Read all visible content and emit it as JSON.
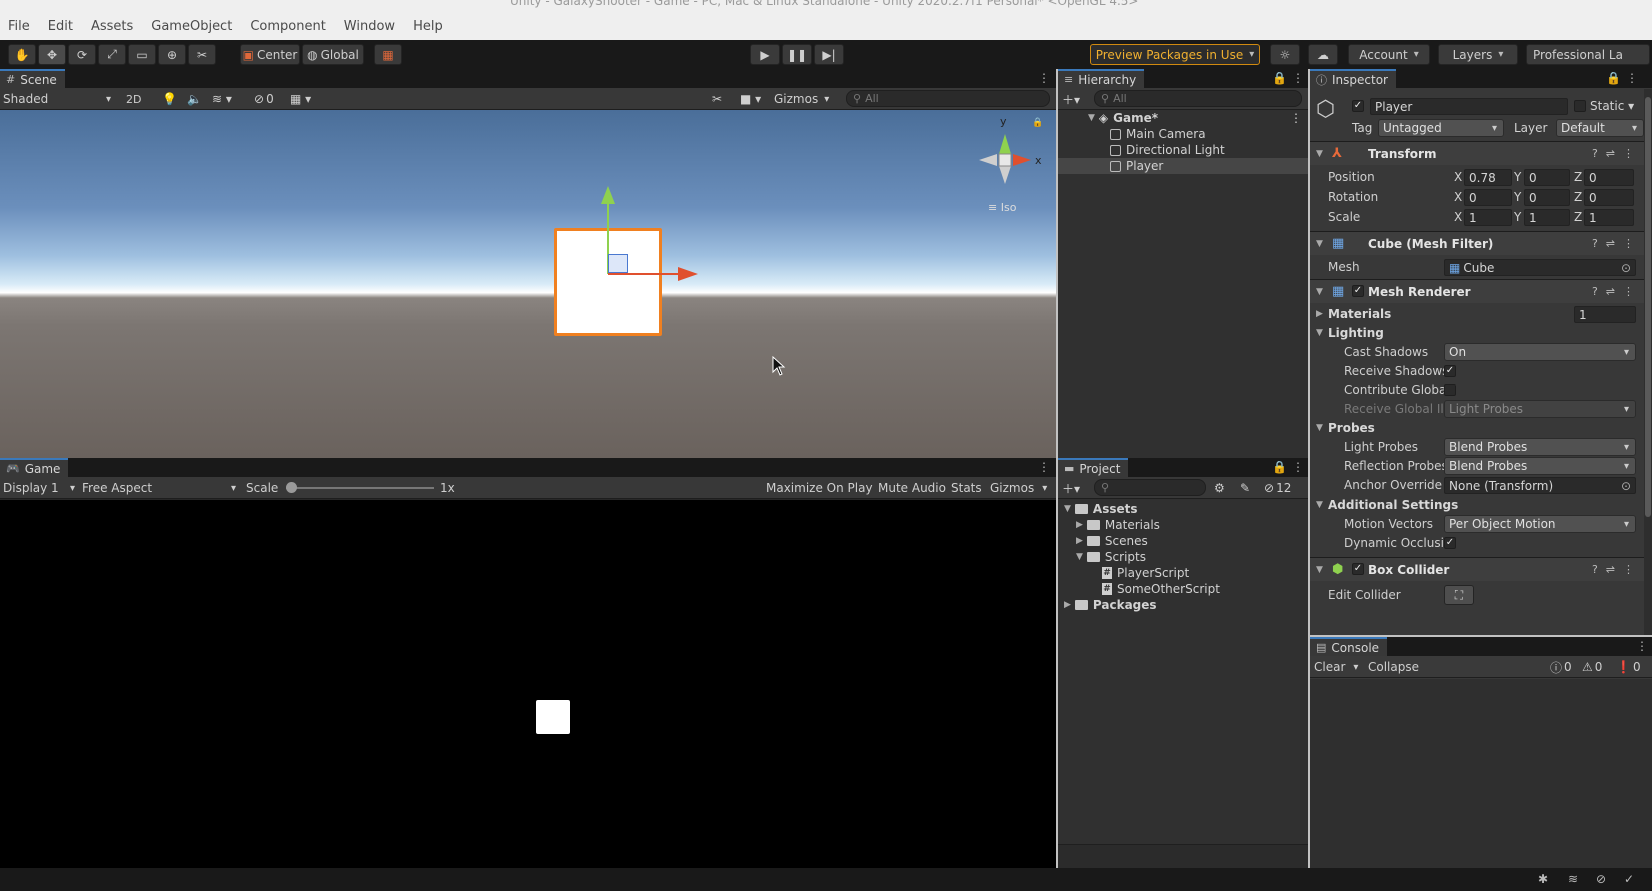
{
  "window": {
    "title": "Unity - GalaxyShooter - Game - PC, Mac & Linux Standalone - Unity 2020.2.7f1 Personal* <OpenGL 4.5>"
  },
  "menu": [
    "File",
    "Edit",
    "Assets",
    "GameObject",
    "Component",
    "Window",
    "Help"
  ],
  "toolbar": {
    "center_label": "Center",
    "global_label": "Global",
    "preview_packages": "Preview Packages in Use",
    "account": "Account",
    "layers": "Layers",
    "layout": "Professional La"
  },
  "scene": {
    "tab": "Scene",
    "shading": "Shaded",
    "mode_2d": "2D",
    "hidden_count": "0",
    "gizmos": "Gizmos",
    "search_placeholder": "All",
    "axis_y": "y",
    "axis_x": "x",
    "iso": "Iso"
  },
  "game": {
    "tab": "Game",
    "display": "Display 1",
    "aspect": "Free Aspect",
    "scale_label": "Scale",
    "scale_value": 0.0,
    "scale_text": "1x",
    "maximize": "Maximize On Play",
    "mute": "Mute Audio",
    "stats": "Stats",
    "gizmos": "Gizmos"
  },
  "hierarchy": {
    "tab": "Hierarchy",
    "search_placeholder": "All",
    "scene_name": "Game*",
    "items": [
      "Main Camera",
      "Directional Light",
      "Player"
    ]
  },
  "project": {
    "tab": "Project",
    "hidden_count": "12",
    "tree": {
      "assets": "Assets",
      "materials": "Materials",
      "scenes": "Scenes",
      "scripts": "Scripts",
      "player_script": "PlayerScript",
      "other_script": "SomeOtherScript",
      "packages": "Packages"
    }
  },
  "inspector": {
    "tab": "Inspector",
    "object_name": "Player",
    "static_label": "Static",
    "tag_label": "Tag",
    "tag_value": "Untagged",
    "layer_label": "Layer",
    "layer_value": "Default",
    "transform": {
      "title": "Transform",
      "position_label": "Position",
      "pos_x": "0.78",
      "pos_y": "0",
      "pos_z": "0",
      "rotation_label": "Rotation",
      "rot_x": "0",
      "rot_y": "0",
      "rot_z": "0",
      "scale_label": "Scale",
      "sc_x": "1",
      "sc_y": "1",
      "sc_z": "1",
      "axis_x": "X",
      "axis_y": "Y",
      "axis_z": "Z"
    },
    "mesh_filter": {
      "title": "Cube (Mesh Filter)",
      "mesh_label": "Mesh",
      "mesh_value": "Cube"
    },
    "mesh_renderer": {
      "title": "Mesh Renderer",
      "materials_label": "Materials",
      "materials_count": "1",
      "lighting_label": "Lighting",
      "cast_shadows_label": "Cast Shadows",
      "cast_shadows_value": "On",
      "receive_shadows_label": "Receive Shadows",
      "contribute_gi_label": "Contribute Global I",
      "receive_gi_label": "Receive Global Illu",
      "receive_gi_value": "Light Probes",
      "probes_label": "Probes",
      "light_probes_label": "Light Probes",
      "light_probes_value": "Blend Probes",
      "reflection_probes_label": "Reflection Probes",
      "reflection_probes_value": "Blend Probes",
      "anchor_override_label": "Anchor Override",
      "anchor_override_value": "None (Transform)",
      "additional_label": "Additional Settings",
      "motion_vectors_label": "Motion Vectors",
      "motion_vectors_value": "Per Object Motion",
      "dynamic_occlusion_label": "Dynamic Occlusio"
    },
    "box_collider": {
      "title": "Box Collider",
      "edit_label": "Edit Collider"
    }
  },
  "console": {
    "tab": "Console",
    "clear": "Clear",
    "collapse": "Collapse",
    "info_count": "0",
    "warn_count": "0",
    "error_count": "0"
  }
}
